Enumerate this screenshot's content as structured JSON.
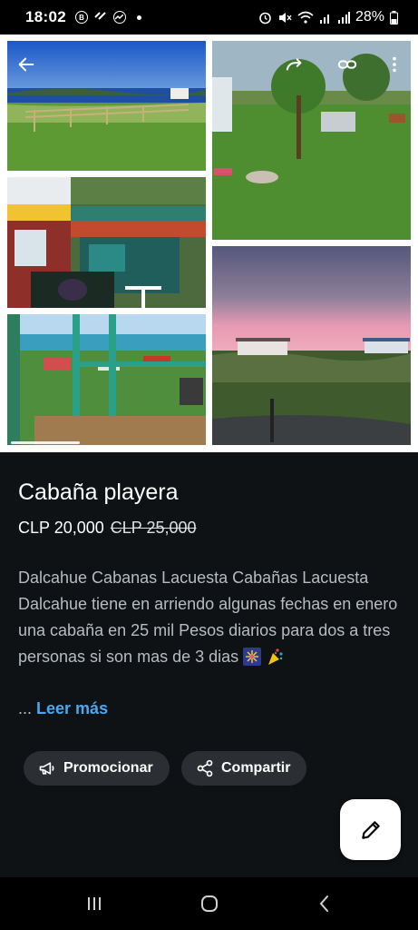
{
  "status_bar": {
    "time": "18:02",
    "battery": "28%",
    "app_icons": [
      "b-icon",
      "link-icon",
      "messenger-icon"
    ],
    "system_icons": [
      "alarm-icon",
      "mute-icon",
      "wifi-icon",
      "signal-icon",
      "signal-icon",
      "battery-icon"
    ]
  },
  "top_actions": {
    "back": "back-arrow-icon",
    "forward": "share-forward-icon",
    "link": "link-icon",
    "more": "more-vertical-icon"
  },
  "listing": {
    "title": "Cabaña playera",
    "price": "CLP 20,000",
    "old_price": "CLP 25,000",
    "description": "Dalcahue Cabanas Lacuesta Cabañas Lacuesta Dalcahue  tiene en arriendo algunas fechas en enero una cabaña en 25 mil Pesos diarios para dos a tres personas si son mas de 3 dias",
    "emoji_icons": [
      "fireworks-icon",
      "confetti-icon"
    ],
    "read_more_prefix": "...",
    "read_more_label": "Leer más"
  },
  "actions": {
    "promote_label": "Promocionar",
    "share_label": "Compartir"
  },
  "colors": {
    "background": "#0f1215",
    "pill": "#2b2e33",
    "link": "#4aa8ef",
    "text_muted": "#b7bcc2"
  }
}
